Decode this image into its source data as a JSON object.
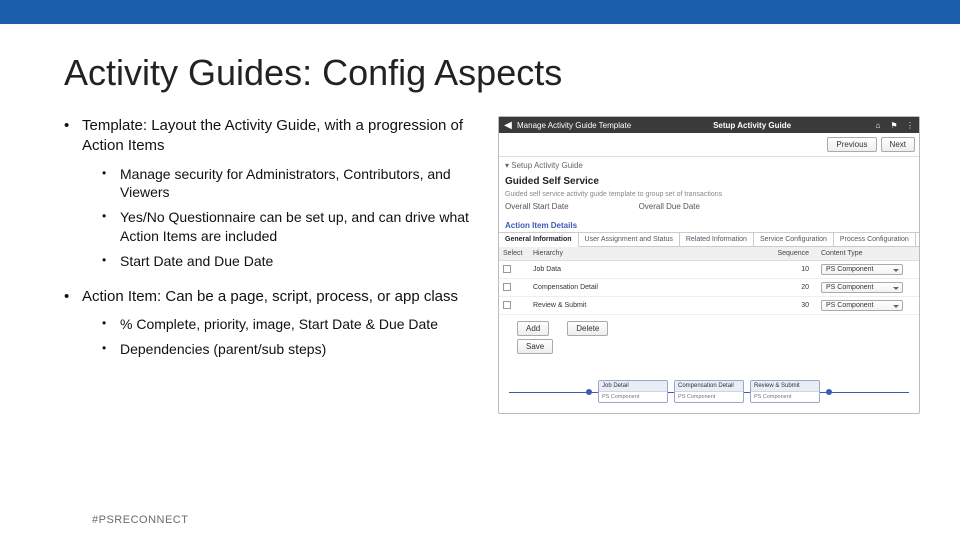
{
  "title": "Activity Guides: Config Aspects",
  "bullets": {
    "b1_1": "Template: Layout the Activity Guide, with a progression of Action Items",
    "b2_1": "Manage security for Administrators, Contributors, and Viewers",
    "b2_2": "Yes/No Questionnaire can be set up, and can drive what Action Items are included",
    "b2_3": "Start Date and Due Date",
    "b1_2": "Action Item: Can be a page, script, process, or app class",
    "b2_4": "% Complete, priority, image, Start Date & Due Date",
    "b2_5": "Dependencies (parent/sub steps)"
  },
  "footer": "#PSRECONNECT",
  "shot": {
    "header_left": "Manage Activity Guide Template",
    "header_mid": "Setup Activity Guide",
    "prev": "Previous",
    "next": "Next",
    "crumb": "Setup Activity Guide",
    "section_title": "Guided Self Service",
    "section_sub": "Guided self service activity guide template to group set of transactions",
    "start_date": "Overall Start Date",
    "due_date": "Overall Due Date",
    "aid_label": "Action Item Details",
    "tabs": [
      "General Information",
      "User Assignment and Status",
      "Related Information",
      "Service Configuration",
      "Process Configuration"
    ],
    "cols": {
      "select": "Select",
      "hierarchy": "Hierarchy",
      "sequence": "Sequence",
      "content": "Content Type"
    },
    "rows": [
      {
        "hierarchy": "Job Data",
        "sequence": "10",
        "content": "PS Component"
      },
      {
        "hierarchy": "Compensation Detail",
        "sequence": "20",
        "content": "PS Component"
      },
      {
        "hierarchy": "Review & Submit",
        "sequence": "30",
        "content": "PS Component"
      }
    ],
    "add": "Add",
    "delete": "Delete",
    "save": "Save",
    "flow": [
      {
        "title": "Job Detail",
        "sub": "PS Component"
      },
      {
        "title": "Compensation Detail",
        "sub": "PS Component"
      },
      {
        "title": "Review & Submit",
        "sub": "PS Component"
      }
    ]
  }
}
